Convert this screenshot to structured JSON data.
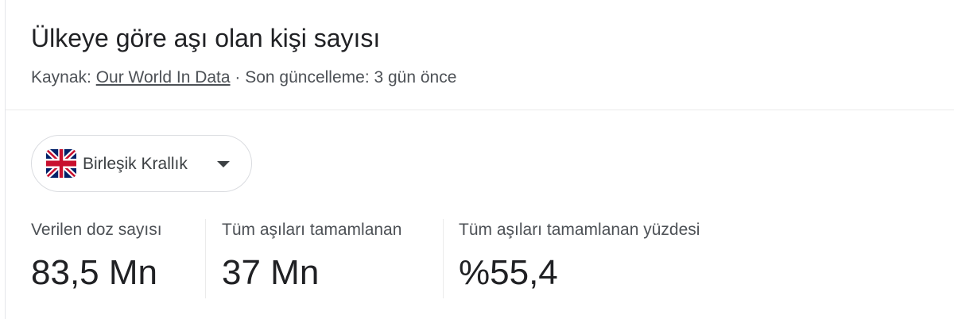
{
  "header": {
    "title": "Ülkeye göre aşı olan kişi sayısı",
    "source_prefix": "Kaynak: ",
    "source_name": "Our World In Data",
    "update_text": " · Son güncelleme: 3 gün önce"
  },
  "country_selector": {
    "selected": "Birleşik Krallık",
    "flag_icon": "uk-flag-icon",
    "caret_icon": "caret-down-icon"
  },
  "stats": [
    {
      "label": "Verilen doz sayısı",
      "value": "83,5 Mn"
    },
    {
      "label": "Tüm aşıları tamamlanan",
      "value": "37 Mn"
    },
    {
      "label": "Tüm aşıları tamamlanan yüzdesi",
      "value": "%55,4"
    }
  ],
  "colors": {
    "title_text": "#202124",
    "secondary_text": "#4d5156",
    "border": "#dadce0",
    "flag_blue": "#012169",
    "flag_red": "#c8102e"
  }
}
